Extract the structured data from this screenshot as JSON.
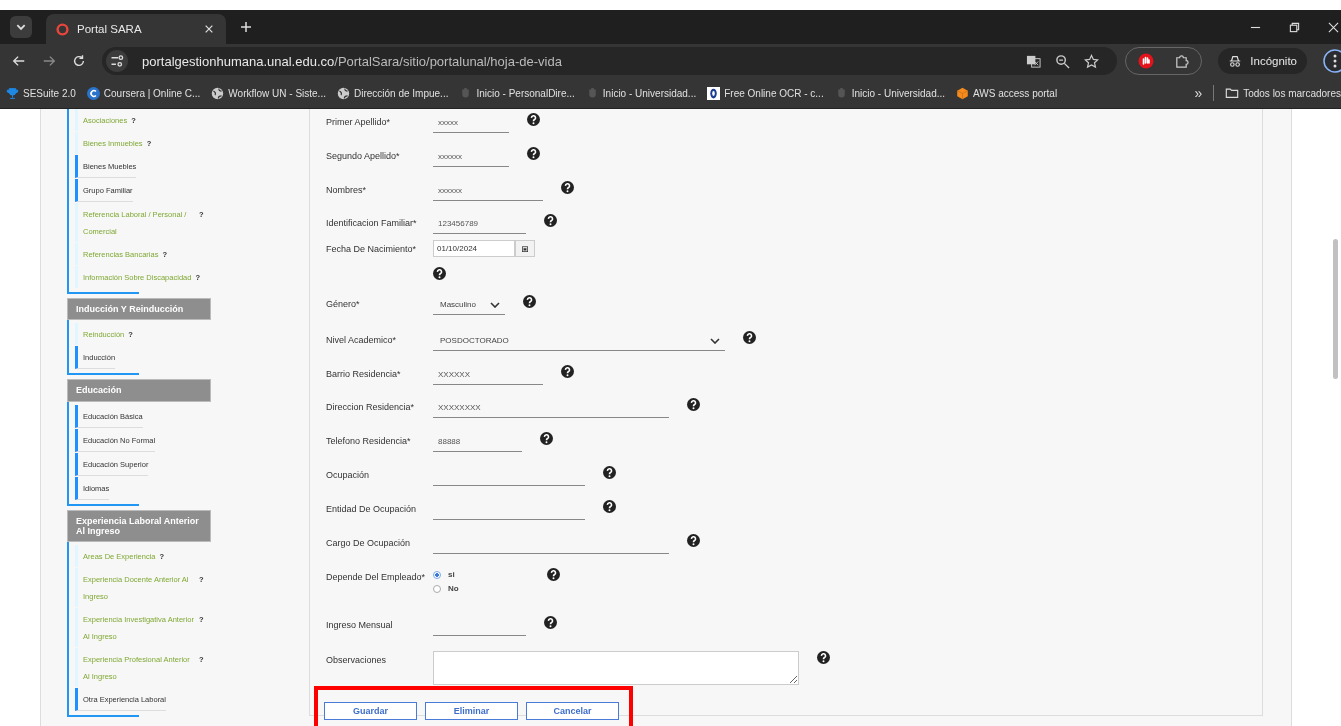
{
  "browser": {
    "tab": {
      "title": "Portal SARA"
    },
    "url": {
      "host": "portalgestionhumana.unal.edu.co",
      "path": "/PortalSara/sitio/portalunal/hoja-de-vida"
    },
    "profile_label": "Incógnito",
    "bookmarks": [
      {
        "label": "SESuite 2.0",
        "kind": "trophy"
      },
      {
        "label": "Coursera | Online C...",
        "kind": "coursera"
      },
      {
        "label": "Workflow UN - Siste...",
        "kind": "globe"
      },
      {
        "label": "Dirección de Impue...",
        "kind": "globe"
      },
      {
        "label": "Inicio - PersonalDire...",
        "kind": "crest"
      },
      {
        "label": "Inicio - Universidad...",
        "kind": "crest"
      },
      {
        "label": "Free Online OCR - c...",
        "kind": "ocr"
      },
      {
        "label": "Inicio - Universidad...",
        "kind": "crest"
      },
      {
        "label": "AWS access portal",
        "kind": "cube"
      }
    ],
    "more_bookmarks": "»",
    "all_bookmarks": "Todos los marcadores"
  },
  "sidebar": {
    "groups": [
      {
        "items": [
          {
            "label": "Asociaciones",
            "kind": "help",
            "help": "?"
          },
          {
            "label": "Bienes Inmuebles",
            "kind": "help",
            "help": "?"
          },
          {
            "label": "Bienes Muebles",
            "kind": "plain"
          },
          {
            "label": "Grupo Familiar",
            "kind": "plain"
          },
          {
            "label": "Referencia Laboral / Personal / Comercial",
            "kind": "help",
            "help": "?"
          },
          {
            "label": "Referencias Bancarias",
            "kind": "help",
            "help": "?"
          },
          {
            "label": "Información Sobre Discapacidad",
            "kind": "help",
            "help": "?"
          }
        ]
      },
      {
        "title": "Inducción Y Reinducción",
        "items": [
          {
            "label": "Reinducción",
            "kind": "help",
            "help": "?"
          },
          {
            "label": "Inducción",
            "kind": "plain"
          }
        ]
      },
      {
        "title": "Educación",
        "items": [
          {
            "label": "Educación Básica",
            "kind": "plain"
          },
          {
            "label": "Educación No Formal",
            "kind": "plain"
          },
          {
            "label": "Educación Superior",
            "kind": "plain"
          },
          {
            "label": "Idiomas",
            "kind": "plain"
          }
        ]
      },
      {
        "title": "Experiencia Laboral Anterior Al Ingreso",
        "items": [
          {
            "label": "Areas De Experiencia",
            "kind": "help",
            "help": "?"
          },
          {
            "label": "Experiencia Docente Anterior Al Ingreso",
            "kind": "help",
            "help": "?"
          },
          {
            "label": "Experiencia Investigativa Anterior Al Ingreso",
            "kind": "help",
            "help": "?"
          },
          {
            "label": "Experiencia Profesional Anterior Al Ingreso",
            "kind": "help",
            "help": "?"
          },
          {
            "label": "Otra Experiencia Laboral",
            "kind": "plain"
          }
        ]
      }
    ]
  },
  "form": {
    "fields": [
      {
        "label": "Primer Apellido*",
        "kind": "text",
        "value": "xxxxx"
      },
      {
        "label": "Segundo Apellido*",
        "kind": "text",
        "value": "xxxxxx"
      },
      {
        "label": "Nombres*",
        "kind": "text",
        "value": "xxxxxx"
      },
      {
        "label": "Identificacion Familiar*",
        "kind": "text",
        "value": "123456789"
      },
      {
        "label": "Fecha De Nacimiento*",
        "kind": "date",
        "value": "01/10/2024"
      },
      {
        "label": "Género*",
        "kind": "select",
        "value": "Masculino"
      },
      {
        "label": "Nivel Academico*",
        "kind": "select",
        "value": "POSDOCTORADO"
      },
      {
        "label": "Barrio Residencia*",
        "kind": "text",
        "value": "XXXXXX"
      },
      {
        "label": "Direccion Residencia*",
        "kind": "text",
        "value": "XXXXXXXX"
      },
      {
        "label": "Telefono Residencia*",
        "kind": "text",
        "value": "88888"
      },
      {
        "label": "Ocupación",
        "kind": "text"
      },
      {
        "label": "Entidad De Ocupación",
        "kind": "text"
      },
      {
        "label": "Cargo De Ocupación",
        "kind": "text"
      },
      {
        "label": "Depende Del Empleado*",
        "kind": "radio",
        "options": [
          {
            "label": "si",
            "selected": true
          },
          {
            "label": "No",
            "selected": false
          }
        ]
      },
      {
        "label": "Ingreso Mensual",
        "kind": "text"
      },
      {
        "label": "Observaciones",
        "kind": "textarea"
      }
    ],
    "buttons": [
      "Guardar",
      "Eliminar",
      "Cancelar"
    ]
  }
}
